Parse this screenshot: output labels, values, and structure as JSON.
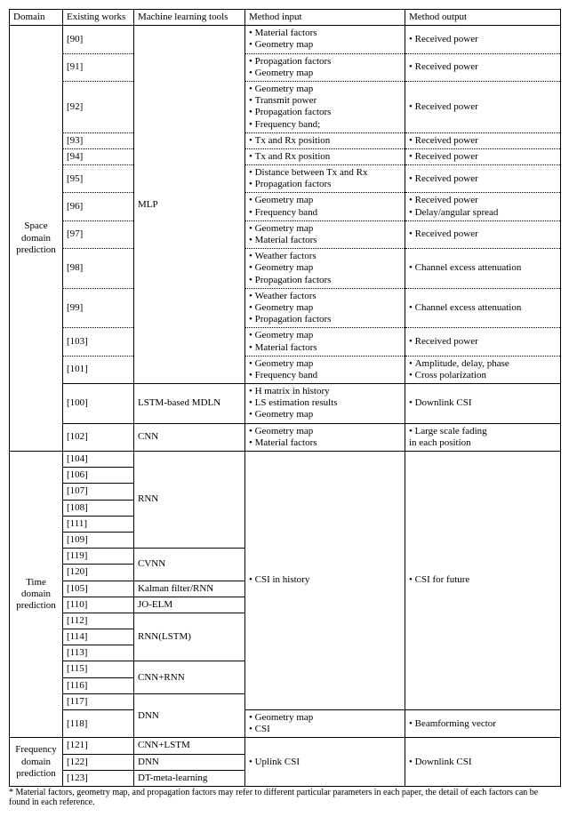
{
  "headers": {
    "c1": "Domain",
    "c2": "Existing works",
    "c3": "Machine learning tools",
    "c4": "Method input",
    "c5": "Method output"
  },
  "space": {
    "label": "Space domain prediction",
    "rows": [
      {
        "ref": "[90]",
        "tool": "",
        "in": [
          "Material factors",
          "Geometry map"
        ],
        "out": [
          "Received power"
        ]
      },
      {
        "ref": "[91]",
        "tool": "",
        "in": [
          "Propagation factors",
          "Geometry map"
        ],
        "out": [
          "Received power"
        ]
      },
      {
        "ref": "[92]",
        "tool": "",
        "in": [
          "Geometry map",
          "Transmit power",
          "Propagation factors",
          "Frequency band;"
        ],
        "out": [
          "Received power"
        ]
      },
      {
        "ref": "[93]",
        "tool": "",
        "in": [
          "Tx and Rx position"
        ],
        "out": [
          "Received power"
        ]
      },
      {
        "ref": "[94]",
        "tool": "",
        "in": [
          "Tx and Rx position"
        ],
        "out": [
          "Received power"
        ]
      },
      {
        "ref": "[95]",
        "tool": "",
        "in": [
          "Distance between Tx and Rx",
          "Propagation factors"
        ],
        "out": [
          "Received power"
        ]
      },
      {
        "ref": "[96]",
        "tool": "",
        "in": [
          "Geometry map",
          "Frequency band"
        ],
        "out": [
          "Received power",
          "Delay/angular spread"
        ]
      },
      {
        "ref": "[97]",
        "tool": "",
        "in": [
          "Geometry map",
          "Material factors"
        ],
        "out": [
          "Received power"
        ]
      },
      {
        "ref": "[98]",
        "tool": "",
        "in": [
          "Weather factors",
          "Geometry map",
          "Propagation factors"
        ],
        "out": [
          "Channel excess attenuation"
        ]
      },
      {
        "ref": "[99]",
        "tool": "",
        "in": [
          "Weather factors",
          "Geometry map",
          "Propagation factors"
        ],
        "out": [
          "Channel excess attenuation"
        ]
      },
      {
        "ref": "[103]",
        "tool": "",
        "in": [
          "Geometry map",
          "Material factors"
        ],
        "out": [
          "Received power"
        ]
      },
      {
        "ref": "[101]",
        "tool": "",
        "in": [
          "Geometry map",
          "Frequency band"
        ],
        "out": [
          "Amplitude, delay, phase",
          "Cross polarization"
        ]
      },
      {
        "ref": "[100]",
        "tool": "LSTM-based MDLN",
        "in": [
          "H matrix in history",
          "LS estimation results",
          "Geometry map"
        ],
        "out": [
          "Downlink CSI"
        ]
      },
      {
        "ref": "[102]",
        "tool": "CNN",
        "in": [
          "Geometry map",
          "Material factors"
        ],
        "out": [
          "Large scale fading",
          "in each position"
        ],
        "out_nolist": true
      }
    ],
    "mlp": "MLP"
  },
  "time": {
    "label": "Time domain prediction",
    "shared_in": "CSI in history",
    "shared_out": "CSI for future",
    "r118_in": [
      "Geometry map",
      "CSI"
    ],
    "r118_out": [
      "Beamforming vector"
    ],
    "refs": [
      "[104]",
      "[106]",
      "[107]",
      "[108]",
      "[111]",
      "[109]",
      "[119]",
      "[120]",
      "[105]",
      "[110]",
      "[112]",
      "[114]",
      "[113]",
      "[115]",
      "[116]",
      "[117]",
      "[118]"
    ],
    "tools": {
      "rnn": "RNN",
      "cvnn": "CVNN",
      "kf": "Kalman filter/RNN",
      "jo": "JO-ELM",
      "lstm": "RNN(LSTM)",
      "cnnrnn": "CNN+RNN",
      "dnn": "DNN"
    }
  },
  "freq": {
    "label": "Frequency domain prediction",
    "shared_in": "Uplink CSI",
    "shared_out": "Downlink CSI",
    "rows": [
      {
        "ref": "[121]",
        "tool": "CNN+LSTM"
      },
      {
        "ref": "[122]",
        "tool": "DNN"
      },
      {
        "ref": "[123]",
        "tool": "DT-meta-learning"
      }
    ]
  },
  "footnote": "* Material factors, geometry map, and propagation factors may refer to different particular parameters in each paper, the detail of each factors can be found in each reference."
}
